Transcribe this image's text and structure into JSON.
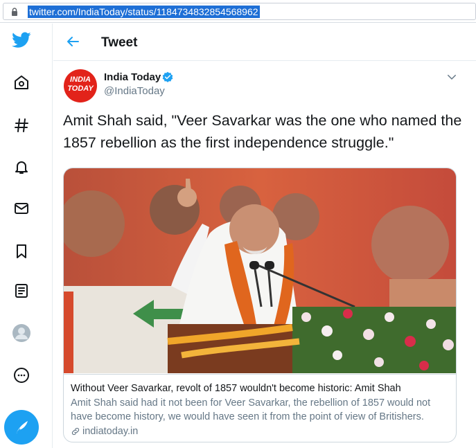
{
  "browser": {
    "url": "twitter.com/IndiaToday/status/1184734832854568962",
    "lock_icon": "lock-icon"
  },
  "nav": {
    "items": [
      {
        "name": "twitter-logo-icon"
      },
      {
        "name": "home-icon"
      },
      {
        "name": "explore-hashtag-icon"
      },
      {
        "name": "notifications-bell-icon"
      },
      {
        "name": "messages-envelope-icon"
      },
      {
        "name": "bookmarks-icon"
      },
      {
        "name": "lists-icon"
      },
      {
        "name": "profile-avatar-icon"
      },
      {
        "name": "more-icon"
      },
      {
        "name": "compose-tweet-icon"
      }
    ],
    "accent_color": "#1da1f2"
  },
  "header": {
    "title": "Tweet"
  },
  "tweet": {
    "author_name": "India Today",
    "author_handle": "@IndiaToday",
    "avatar_text": "INDIA TODAY",
    "verified": true,
    "text": "Amit Shah said, \"Veer Savarkar was the one who named the 1857 rebellion as the first independence struggle.\"",
    "card": {
      "title": "Without Veer Savarkar, revolt of 1857 wouldn't become historic: Amit Shah",
      "description": "Amit Shah said had it not been for Veer Savarkar, the rebellion of 1857 would not have become history, we would have seen it from the point of view of Britishers.",
      "domain": "indiatoday.in"
    }
  }
}
